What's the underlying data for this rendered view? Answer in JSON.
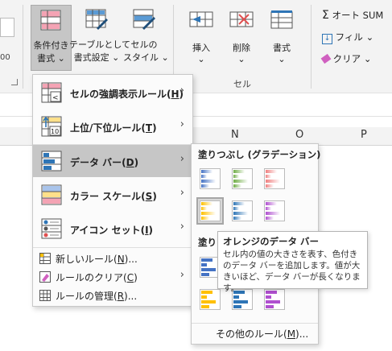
{
  "ribbon": {
    "cf_button": {
      "line1": "条件付き",
      "line2": "書式"
    },
    "table_button": {
      "line1": "テーブルとして",
      "line2": "書式設定"
    },
    "style_button": {
      "line1": "セルの",
      "line2": "スタイル"
    },
    "insert_label": "挿入",
    "delete_label": "削除",
    "format_label": "書式",
    "cells_group_label": "セル",
    "autosum_label": "オート SUM",
    "fill_label": "フィル",
    "clear_label": "クリア",
    "left_partial": "00",
    "chevron": "⌄"
  },
  "columns": [
    "N",
    "O",
    "P"
  ],
  "menu": {
    "items": [
      {
        "label": "セルの強調表示ルール(",
        "key": "H",
        "end": ")"
      },
      {
        "label": "上位/下位ルール(",
        "key": "T",
        "end": ")"
      },
      {
        "label": "データ バー(",
        "key": "D",
        "end": ")"
      },
      {
        "label": "カラー スケール(",
        "key": "S",
        "end": ")"
      },
      {
        "label": "アイコン セット(",
        "key": "I",
        "end": ")"
      }
    ],
    "small": [
      {
        "label": "新しいルール(",
        "key": "N",
        "end": ")..."
      },
      {
        "label": "ルールのクリア(",
        "key": "C",
        "end": ")"
      },
      {
        "label": "ルールの管理(",
        "key": "R",
        "end": ")..."
      }
    ],
    "arrow": "›"
  },
  "submenu": {
    "gradient_heading": "塗りつぶし (グラデーション)",
    "solid_heading_partial": "塗り",
    "more_rules": {
      "label": "その他のルール(",
      "key": "M",
      "end": ")..."
    }
  },
  "databar_colors": {
    "gradient": [
      "#4472c4",
      "#70ad47",
      "#f08080",
      "#ffc000",
      "#2e75b6",
      "#b050d0"
    ],
    "solid": [
      "#4472c4",
      "#ffc000",
      "#2e75b6",
      "#b050d0"
    ]
  },
  "tooltip": {
    "title": "オレンジのデータ バー",
    "body": "セル内の値の大きさを表す、色付きのデータ バーを追加します。値が大きいほど、データ バーが長くなります。"
  }
}
